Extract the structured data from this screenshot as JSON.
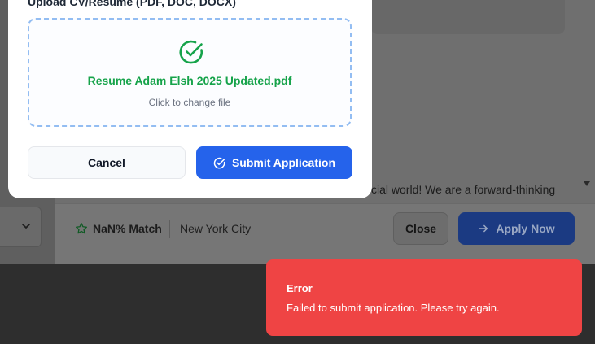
{
  "background": {
    "company_snippet": "cial world! We are a forward-thinking",
    "footer": {
      "match_text": "NaN% Match",
      "location": "New York City",
      "close_label": "Close",
      "apply_label": "Apply Now"
    }
  },
  "modal": {
    "upload_label": "Upload CV/Resume (PDF, DOC, DOCX)",
    "file_name": "Resume Adam Elsh 2025 Updated.pdf",
    "change_hint": "Click to change file",
    "cancel_label": "Cancel",
    "submit_label": "Submit Application"
  },
  "toast": {
    "title": "Error",
    "message": "Failed to submit application. Please try again."
  },
  "colors": {
    "primary": "#2563eb",
    "success": "#16a34a",
    "error": "#ef4444",
    "dropzone_border": "#93bdf2"
  },
  "icons": {
    "dropzone": "check-circle-icon",
    "submit": "check-circle-icon",
    "match": "star-icon",
    "apply": "arrow-right-icon",
    "dropdown": "chevron-down-icon"
  }
}
